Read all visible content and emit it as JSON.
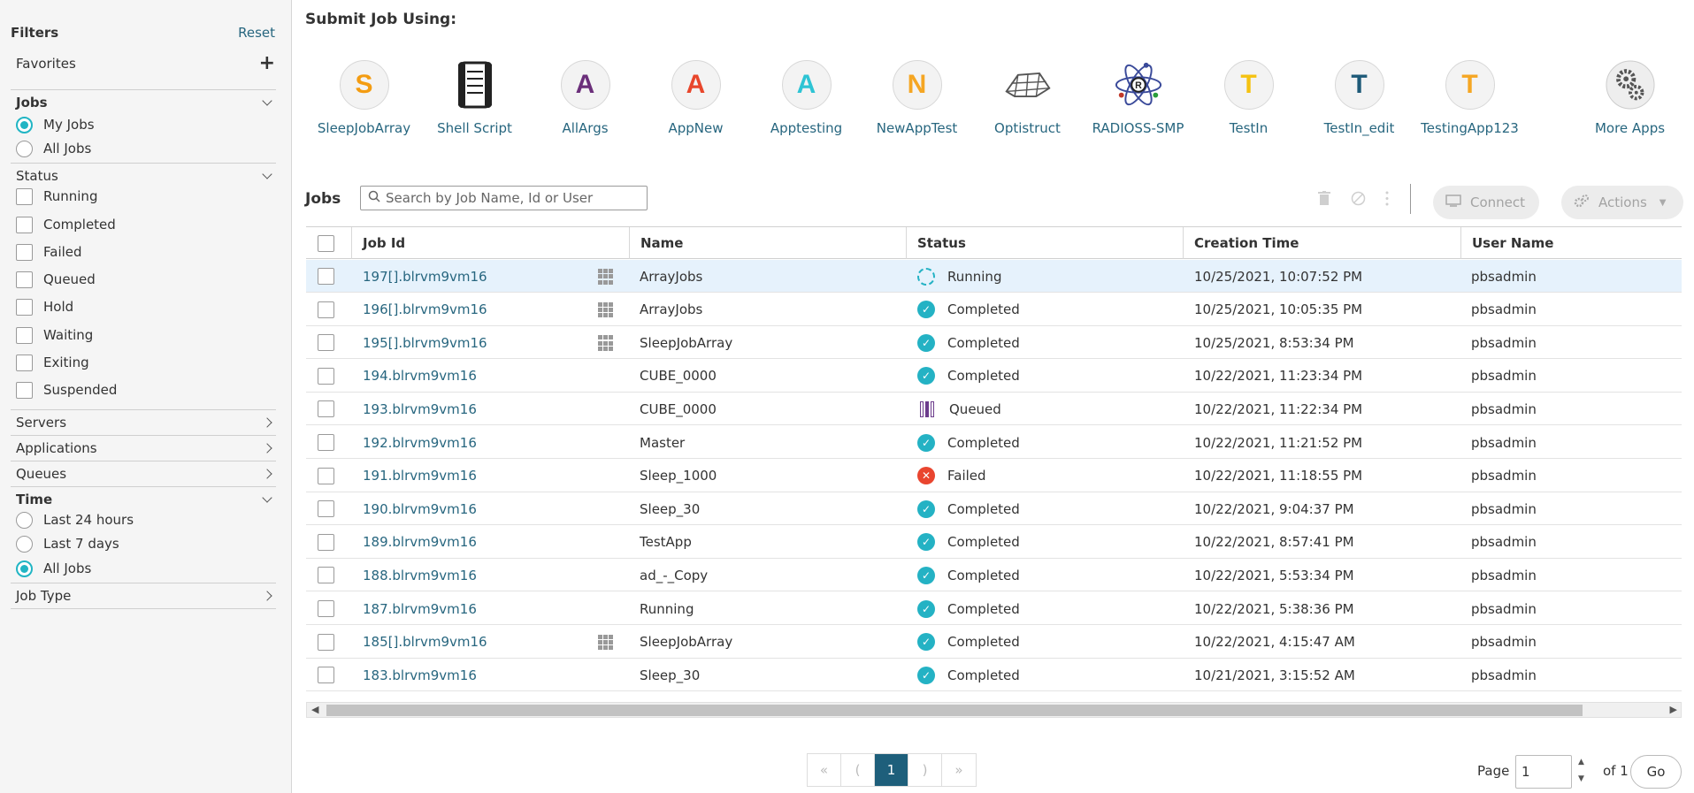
{
  "sidebar": {
    "title": "Filters",
    "reset": "Reset",
    "favorites": "Favorites",
    "jobs": {
      "label": "Jobs",
      "options": [
        "My Jobs",
        "All Jobs"
      ],
      "selected": "My Jobs"
    },
    "status": {
      "label": "Status",
      "options": [
        "Running",
        "Completed",
        "Failed",
        "Queued",
        "Hold",
        "Waiting",
        "Exiting",
        "Suspended"
      ]
    },
    "collapsed": [
      "Servers",
      "Applications",
      "Queues"
    ],
    "time": {
      "label": "Time",
      "options": [
        "Last 24 hours",
        "Last 7 days",
        "All Jobs"
      ],
      "selected": "All Jobs"
    },
    "job_type": "Job Type"
  },
  "submit": {
    "title": "Submit Job Using:",
    "apps": [
      {
        "label": "SleepJobArray",
        "letter": "S",
        "color": "#f39c12"
      },
      {
        "label": "Shell Script",
        "letter": "",
        "color": "#222222"
      },
      {
        "label": "AllArgs",
        "letter": "A",
        "color": "#6b2f7a"
      },
      {
        "label": "AppNew",
        "letter": "A",
        "color": "#e8462b"
      },
      {
        "label": "Apptesting",
        "letter": "A",
        "color": "#2ec4d4"
      },
      {
        "label": "NewAppTest",
        "letter": "N",
        "color": "#f5a623"
      },
      {
        "label": "Optistruct",
        "letter": "",
        "color": "#555555"
      },
      {
        "label": "RADIOSS-SMP",
        "letter": "",
        "color": "#3a4a9a"
      },
      {
        "label": "TestIn",
        "letter": "T",
        "color": "#f5c211"
      },
      {
        "label": "TestIn_edit",
        "letter": "T",
        "color": "#1e5a78"
      },
      {
        "label": "TestingApp123",
        "letter": "T",
        "color": "#f5a623"
      }
    ],
    "more_apps": "More Apps"
  },
  "jobs": {
    "label": "Jobs",
    "search_placeholder": "Search by Job Name, Id or User",
    "connect": "Connect",
    "actions": "Actions",
    "columns": [
      "Job Id",
      "Name",
      "Status",
      "Creation Time",
      "User Name"
    ],
    "rows": [
      {
        "id": "197[].blrvm9vm16",
        "array": true,
        "name": "ArrayJobs",
        "status": "Running",
        "time": "10/25/2021, 10:07:52 PM",
        "user": "pbsadmin"
      },
      {
        "id": "196[].blrvm9vm16",
        "array": true,
        "name": "ArrayJobs",
        "status": "Completed",
        "time": "10/25/2021, 10:05:35 PM",
        "user": "pbsadmin"
      },
      {
        "id": "195[].blrvm9vm16",
        "array": true,
        "name": "SleepJobArray",
        "status": "Completed",
        "time": "10/25/2021, 8:53:34 PM",
        "user": "pbsadmin"
      },
      {
        "id": "194.blrvm9vm16",
        "array": false,
        "name": "CUBE_0000",
        "status": "Completed",
        "time": "10/22/2021, 11:23:34 PM",
        "user": "pbsadmin"
      },
      {
        "id": "193.blrvm9vm16",
        "array": false,
        "name": "CUBE_0000",
        "status": "Queued",
        "time": "10/22/2021, 11:22:34 PM",
        "user": "pbsadmin"
      },
      {
        "id": "192.blrvm9vm16",
        "array": false,
        "name": "Master",
        "status": "Completed",
        "time": "10/22/2021, 11:21:52 PM",
        "user": "pbsadmin"
      },
      {
        "id": "191.blrvm9vm16",
        "array": false,
        "name": "Sleep_1000",
        "status": "Failed",
        "time": "10/22/2021, 11:18:55 PM",
        "user": "pbsadmin"
      },
      {
        "id": "190.blrvm9vm16",
        "array": false,
        "name": "Sleep_30",
        "status": "Completed",
        "time": "10/22/2021, 9:04:37 PM",
        "user": "pbsadmin"
      },
      {
        "id": "189.blrvm9vm16",
        "array": false,
        "name": "TestApp",
        "status": "Completed",
        "time": "10/22/2021, 8:57:41 PM",
        "user": "pbsadmin"
      },
      {
        "id": "188.blrvm9vm16",
        "array": false,
        "name": "ad_-_Copy",
        "status": "Completed",
        "time": "10/22/2021, 5:53:34 PM",
        "user": "pbsadmin"
      },
      {
        "id": "187.blrvm9vm16",
        "array": false,
        "name": "Running",
        "status": "Completed",
        "time": "10/22/2021, 5:38:36 PM",
        "user": "pbsadmin"
      },
      {
        "id": "185[].blrvm9vm16",
        "array": true,
        "name": "SleepJobArray",
        "status": "Completed",
        "time": "10/22/2021, 4:15:47 AM",
        "user": "pbsadmin"
      },
      {
        "id": "183.blrvm9vm16",
        "array": false,
        "name": "Sleep_30",
        "status": "Completed",
        "time": "10/21/2021, 3:15:52 AM",
        "user": "pbsadmin"
      }
    ]
  },
  "pagination": {
    "first": "«",
    "prev": "(",
    "current": "1",
    "next": ")",
    "last": "»",
    "page_label": "Page",
    "page_value": "1",
    "of_label": "of 1",
    "go": "Go"
  }
}
